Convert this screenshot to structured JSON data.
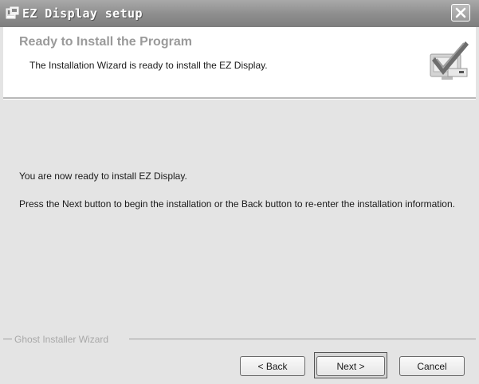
{
  "window": {
    "title": "EZ Display setup",
    "icons": {
      "app": "setup-icon",
      "close": "close-icon",
      "header_graphic": "checkmark-computer-icon"
    }
  },
  "header": {
    "title": "Ready to Install the Program",
    "subtitle": "The Installation Wizard is ready to install the EZ Display."
  },
  "body": {
    "line1": "You are now ready to install EZ Display.",
    "line2": "Press the Next button to begin the installation or the Back button to re-enter the installation information."
  },
  "footer": {
    "group_label": "Ghost Installer Wizard",
    "back_label": "< Back",
    "next_label": "Next >",
    "cancel_label": "Cancel"
  }
}
